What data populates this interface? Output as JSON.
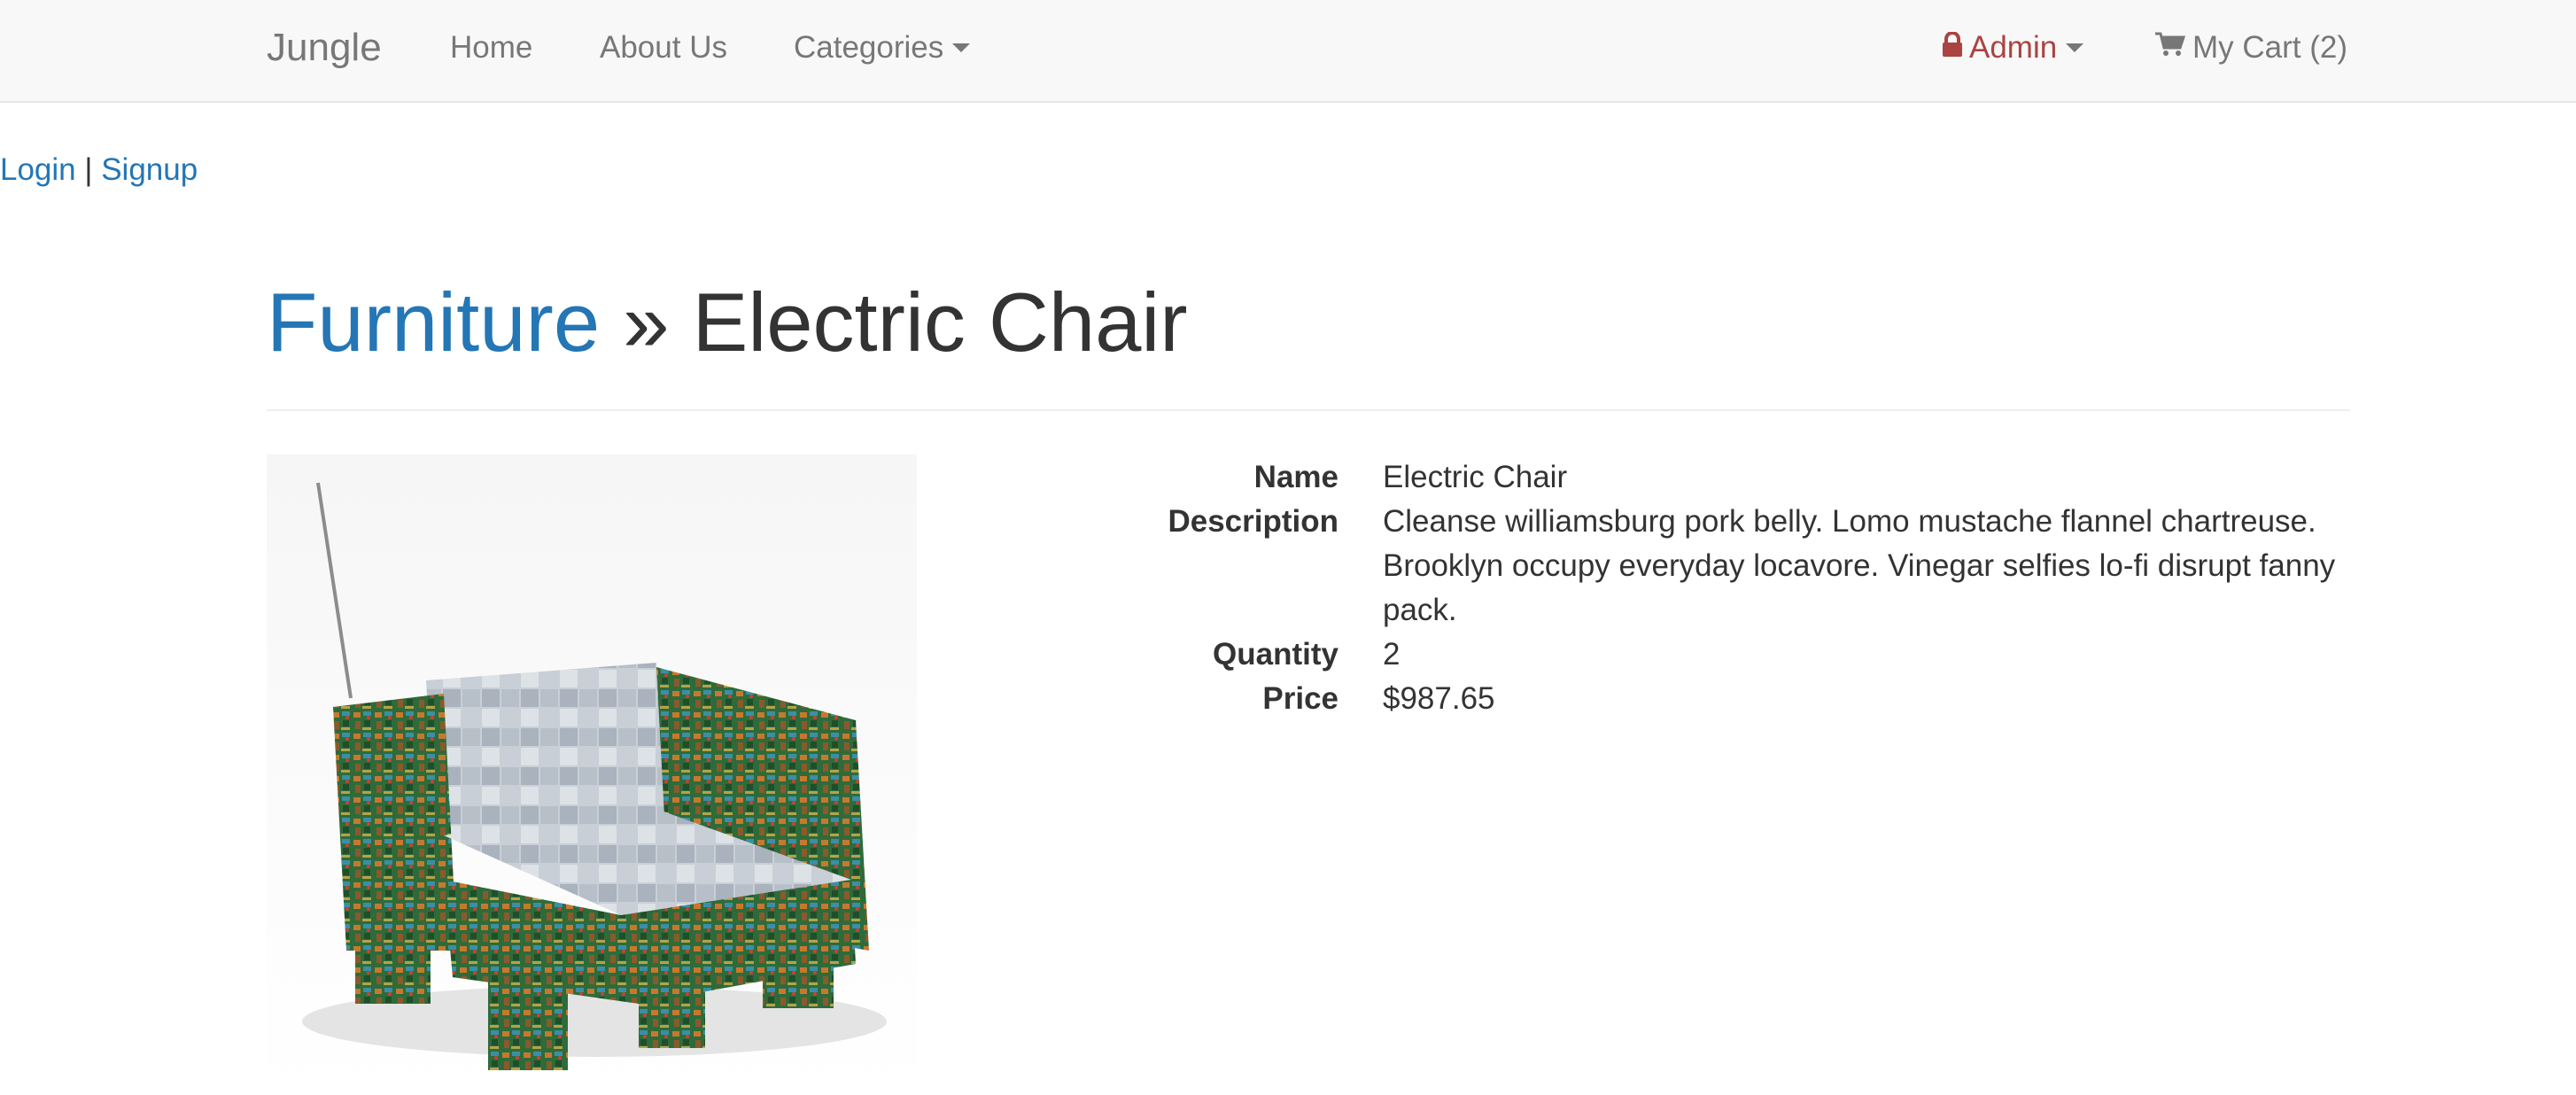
{
  "navbar": {
    "brand": "Jungle",
    "links": {
      "home": "Home",
      "about": "About Us",
      "categories": "Categories"
    },
    "admin": "Admin",
    "cart": "My Cart (2)",
    "icons": {
      "admin": "lock-icon",
      "cart": "shopping-cart-icon",
      "dropdown": "caret-down-icon"
    },
    "colors": {
      "background": "#f8f8f8",
      "link": "#777777",
      "admin": "#a94442"
    }
  },
  "auth": {
    "login": "Login",
    "separator": "|",
    "signup": "Signup"
  },
  "page": {
    "category": "Furniture",
    "separator": "»",
    "title": "Electric Chair",
    "link_color": "#2476b5"
  },
  "product": {
    "image_alt": "Electric Chair",
    "details": [
      {
        "term": "Name",
        "value": "Electric Chair"
      },
      {
        "term": "Description",
        "value": "Cleanse williamsburg pork belly. Lomo mustache flannel chartreuse. Brooklyn occupy everyday locavore. Vinegar selfies lo-fi disrupt fanny pack."
      },
      {
        "term": "Quantity",
        "value": "2"
      },
      {
        "term": "Price",
        "value": "$987.65"
      }
    ]
  }
}
